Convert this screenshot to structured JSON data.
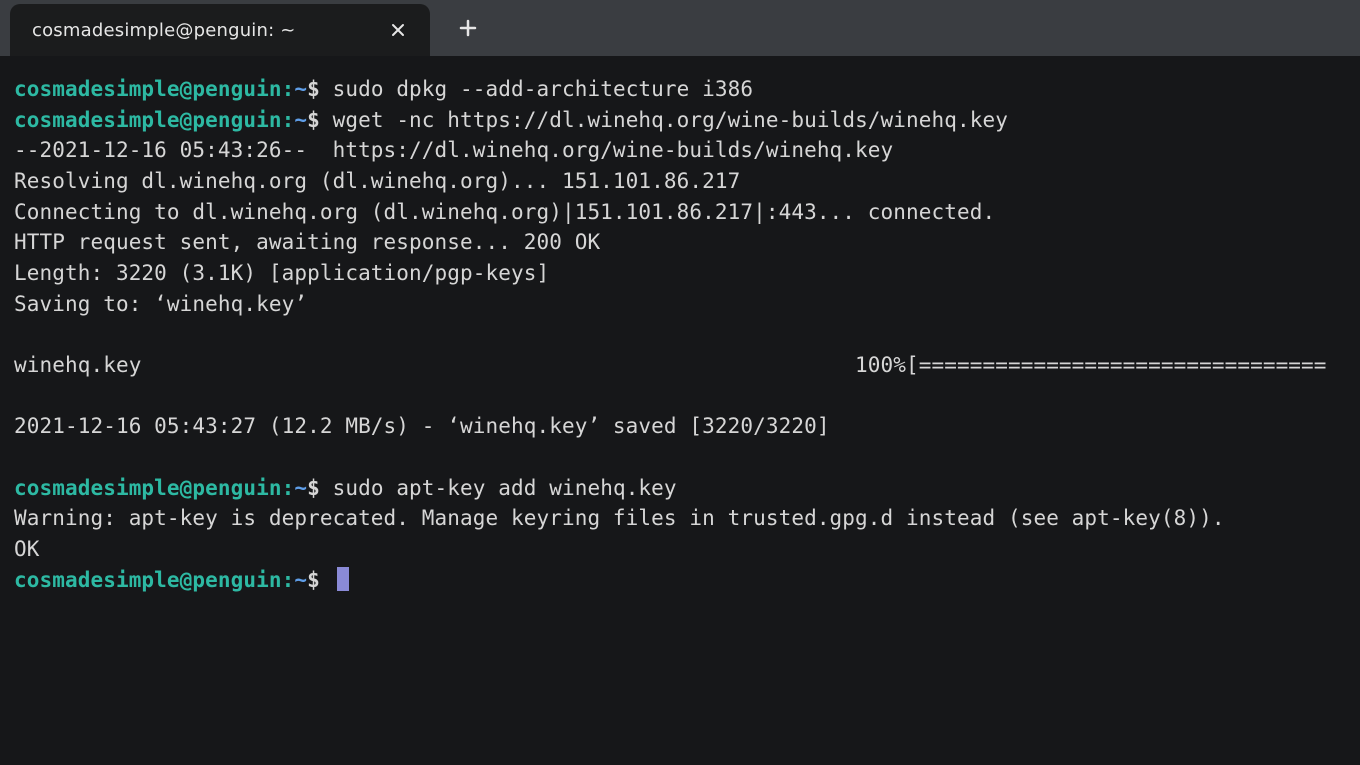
{
  "tab": {
    "title": "cosmadesimple@penguin: ~"
  },
  "lines": [
    {
      "type": "prompt",
      "user": "cosmadesimple@penguin",
      "path": "~",
      "dollar": "$",
      "cmd": " sudo dpkg --add-architecture i386"
    },
    {
      "type": "prompt",
      "user": "cosmadesimple@penguin",
      "path": "~",
      "dollar": "$",
      "cmd": " wget -nc https://dl.winehq.org/wine-builds/winehq.key"
    },
    {
      "type": "out",
      "text": "--2021-12-16 05:43:26--  https://dl.winehq.org/wine-builds/winehq.key"
    },
    {
      "type": "out",
      "text": "Resolving dl.winehq.org (dl.winehq.org)... 151.101.86.217"
    },
    {
      "type": "out",
      "text": "Connecting to dl.winehq.org (dl.winehq.org)|151.101.86.217|:443... connected."
    },
    {
      "type": "out",
      "text": "HTTP request sent, awaiting response... 200 OK"
    },
    {
      "type": "out",
      "text": "Length: 3220 (3.1K) [application/pgp-keys]"
    },
    {
      "type": "out",
      "text": "Saving to: ‘winehq.key’"
    },
    {
      "type": "out",
      "text": ""
    },
    {
      "type": "out",
      "text": "winehq.key                                                        100%[================================"
    },
    {
      "type": "out",
      "text": ""
    },
    {
      "type": "out",
      "text": "2021-12-16 05:43:27 (12.2 MB/s) - ‘winehq.key’ saved [3220/3220]"
    },
    {
      "type": "out",
      "text": ""
    },
    {
      "type": "prompt",
      "user": "cosmadesimple@penguin",
      "path": "~",
      "dollar": "$",
      "cmd": " sudo apt-key add winehq.key"
    },
    {
      "type": "out",
      "text": "Warning: apt-key is deprecated. Manage keyring files in trusted.gpg.d instead (see apt-key(8))."
    },
    {
      "type": "out",
      "text": "OK"
    },
    {
      "type": "prompt",
      "user": "cosmadesimple@penguin",
      "path": "~",
      "dollar": "$",
      "cmd": " ",
      "cursor": true
    }
  ]
}
